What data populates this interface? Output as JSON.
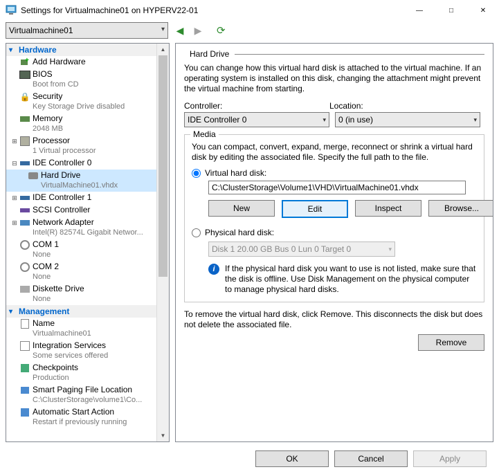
{
  "window": {
    "title": "Settings for Virtualmachine01 on HYPERV22-01"
  },
  "toolbar": {
    "vm_name": "Virtualmachine01"
  },
  "tree": {
    "sections": {
      "hardware": "Hardware",
      "management": "Management"
    },
    "add_hardware": "Add Hardware",
    "bios": "BIOS",
    "bios_sub": "Boot from CD",
    "security": "Security",
    "security_sub": "Key Storage Drive disabled",
    "memory": "Memory",
    "memory_sub": "2048 MB",
    "processor": "Processor",
    "processor_sub": "1 Virtual processor",
    "ide0": "IDE Controller 0",
    "harddrive": "Hard Drive",
    "harddrive_sub": "VirtualMachine01.vhdx",
    "ide1": "IDE Controller 1",
    "scsi": "SCSI Controller",
    "nic": "Network Adapter",
    "nic_sub": "Intel(R) 82574L Gigabit Networ...",
    "com1": "COM 1",
    "com1_sub": "None",
    "com2": "COM 2",
    "com2_sub": "None",
    "fdd": "Diskette Drive",
    "fdd_sub": "None",
    "name": "Name",
    "name_sub": "Virtualmachine01",
    "intsvc": "Integration Services",
    "intsvc_sub": "Some services offered",
    "chk": "Checkpoints",
    "chk_sub": "Production",
    "page": "Smart Paging File Location",
    "page_sub": "C:\\ClusterStorage\\volume1\\Co...",
    "auto": "Automatic Start Action",
    "auto_sub": "Restart if previously running"
  },
  "right": {
    "heading": "Hard Drive",
    "description": "You can change how this virtual hard disk is attached to the virtual machine. If an operating system is installed on this disk, changing the attachment might prevent the virtual machine from starting.",
    "controller_label": "Controller:",
    "controller_value": "IDE Controller 0",
    "location_label": "Location:",
    "location_value": "0 (in use)",
    "media_legend": "Media",
    "media_desc": "You can compact, convert, expand, merge, reconnect or shrink a virtual hard disk by editing the associated file. Specify the full path to the file.",
    "vhd_radio_label": "Virtual hard disk:",
    "vhd_path": "C:\\ClusterStorage\\Volume1\\VHD\\VirtualMachine01.vhdx",
    "btn_new": "New",
    "btn_edit": "Edit",
    "btn_inspect": "Inspect",
    "btn_browse": "Browse...",
    "phys_radio_label": "Physical hard disk:",
    "phys_value": "Disk 1 20.00 GB Bus 0 Lun 0 Target 0",
    "phys_info": "If the physical hard disk you want to use is not listed, make sure that the disk is offline. Use Disk Management on the physical computer to manage physical hard disks.",
    "remove_text": "To remove the virtual hard disk, click Remove. This disconnects the disk but does not delete the associated file.",
    "btn_remove": "Remove"
  },
  "footer": {
    "ok": "OK",
    "cancel": "Cancel",
    "apply": "Apply"
  }
}
